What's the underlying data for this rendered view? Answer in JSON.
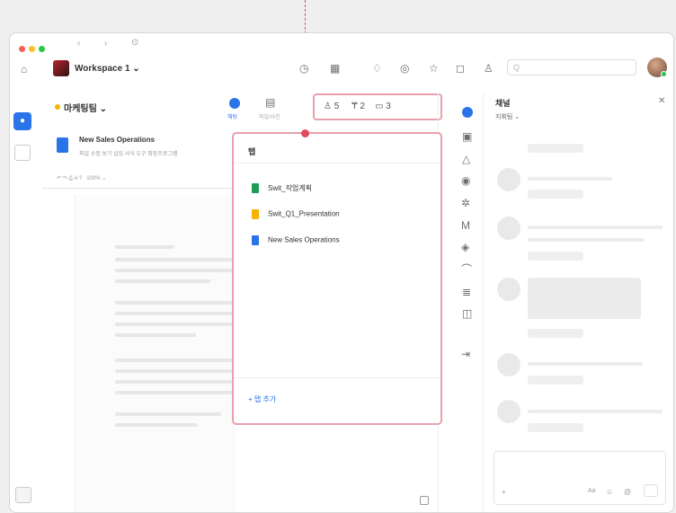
{
  "titlebar": {
    "workspace_name": "Workspace 1",
    "search_placeholder": "Q"
  },
  "doc_panel": {
    "channel_name": "마케팅팀",
    "tab_chat_label": "채팅",
    "tab_files_label": "파일/사진",
    "doc_title": "New Sales Operations",
    "doc_menu": "파일 수정 보기 삽입 서식 도구 확장프로그램",
    "zoom_label": "100%"
  },
  "counters": {
    "members": "5",
    "pinned": "2",
    "tabs": "3"
  },
  "popup": {
    "title": "탭",
    "files": [
      {
        "name": "Swit_작업계획",
        "color": "#1e9e54"
      },
      {
        "name": "Swit_Q1_Presentation",
        "color": "#f4b400"
      },
      {
        "name": "New Sales Operations",
        "color": "#2a73e8"
      }
    ],
    "add_tab_label": "+ 탭 추가"
  },
  "right_panel": {
    "title": "채널",
    "subtitle": "지휘팀",
    "close_glyph": "✕"
  }
}
